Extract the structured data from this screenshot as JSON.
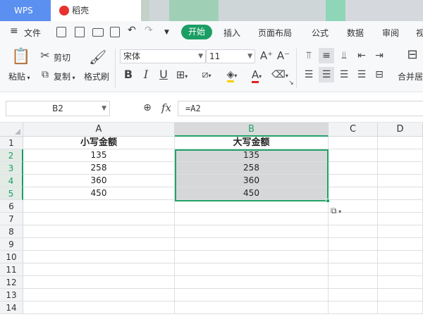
{
  "tabs": {
    "wps": "WPS",
    "daoke": "稻壳"
  },
  "menu": {
    "file": "文件",
    "tabs": [
      "开始",
      "插入",
      "页面布局",
      "公式",
      "数据",
      "审阅",
      "视"
    ]
  },
  "ribbon": {
    "paste": "粘贴",
    "cut": "剪切",
    "copy": "复制",
    "format_painter": "格式刷",
    "font_name": "宋体",
    "font_size": "11",
    "merge": "合并居"
  },
  "formula_bar": {
    "cell_ref": "B2",
    "fx": "fx",
    "formula": "=A2"
  },
  "sheet": {
    "columns": [
      "A",
      "B",
      "C",
      "D"
    ],
    "rows": [
      "1",
      "2",
      "3",
      "4",
      "5",
      "6",
      "7",
      "8",
      "9",
      "10",
      "11",
      "12",
      "13",
      "14"
    ],
    "header": {
      "a": "小写金额",
      "b": "大写金额"
    },
    "data": [
      {
        "a": "135",
        "b": "135"
      },
      {
        "a": "258",
        "b": "258"
      },
      {
        "a": "360",
        "b": "360"
      },
      {
        "a": "450",
        "b": "450"
      }
    ]
  },
  "colors": {
    "accent": "#1a9e64",
    "wps_tab": "#5b8ff0",
    "selection": "#21a366"
  }
}
